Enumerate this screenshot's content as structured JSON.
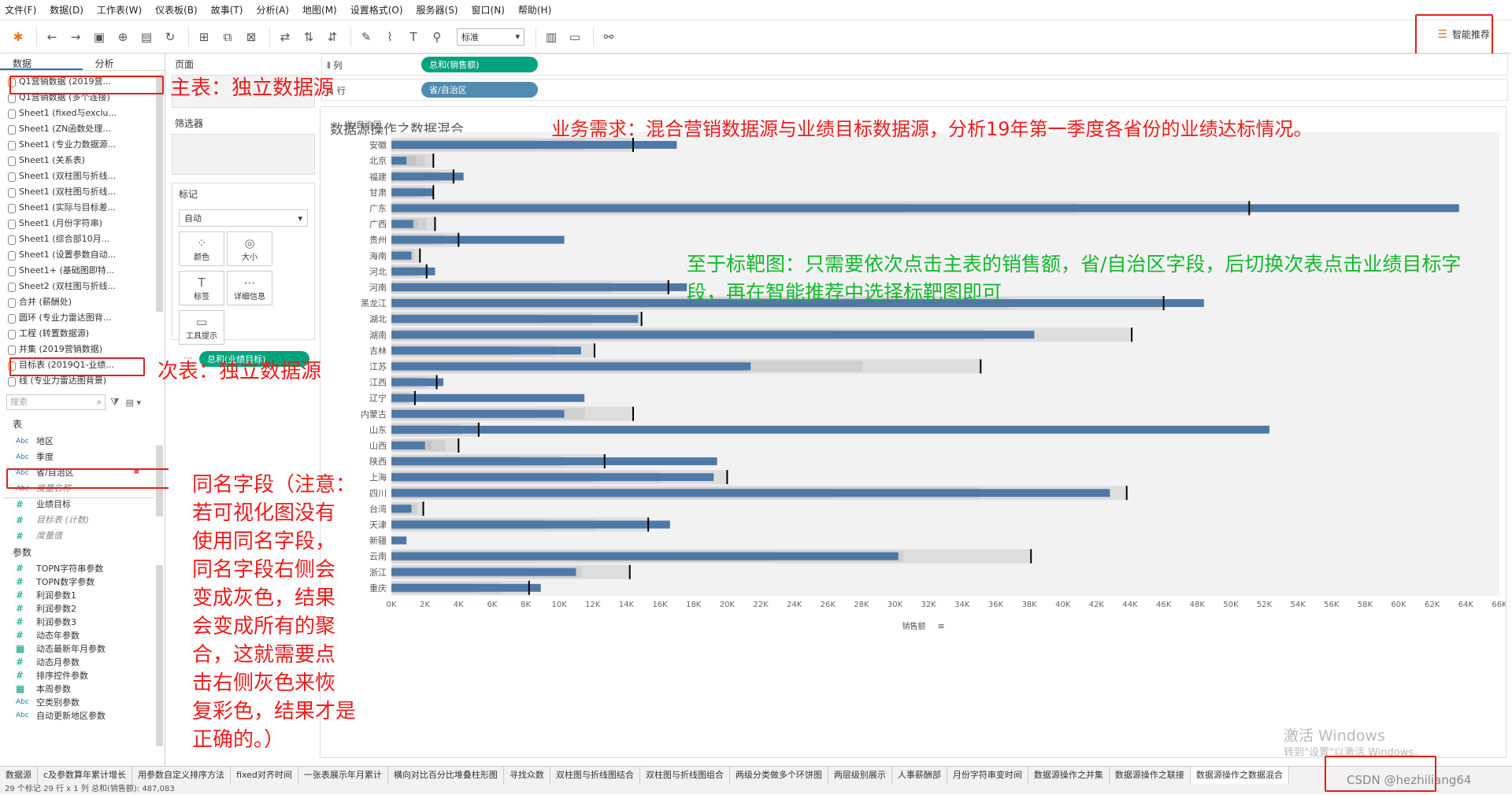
{
  "menu": [
    "文件(F)",
    "数据(D)",
    "工作表(W)",
    "仪表板(B)",
    "故事(T)",
    "分析(A)",
    "地图(M)",
    "设置格式(O)",
    "服务器(S)",
    "窗口(N)",
    "帮助(H)"
  ],
  "toolbar": {
    "fit_value": "标准",
    "smart_label": "智能推荐"
  },
  "left_tabs": {
    "data": "数据",
    "analysis": "分析"
  },
  "datasources": [
    "Q1营销数据 (2019营...",
    "Q1营销数据 (多个连接)",
    "Sheet1 (fixed与exclu...",
    "Sheet1 (ZN函数处理...",
    "Sheet1 (专业力数据源...",
    "Sheet1 (关系表)",
    "Sheet1 (双柱图与折线...",
    "Sheet1 (双柱图与折线...",
    "Sheet1 (实际与目标差...",
    "Sheet1 (月份字符串)",
    "Sheet1 (综合部10月...",
    "Sheet1 (设置参数自动...",
    "Sheet1+ (基础图即特...",
    "Sheet2 (双柱图与折线...",
    "合并 (薪酬处)",
    "圆环 (专业力雷达图背...",
    "工程 (转置数据源)",
    "并集 (2019营销数据)",
    "目标表 (2019Q1-业绩...",
    "线 (专业力雷达图背景)"
  ],
  "search": {
    "placeholder": "搜索"
  },
  "tables_header": "表",
  "fields": [
    {
      "type": "Abc",
      "name": "地区"
    },
    {
      "type": "Abc",
      "name": "季度"
    },
    {
      "type": "Abc",
      "name": "省/自治区"
    },
    {
      "type": "Abc",
      "name": "度量名称",
      "italic": true
    },
    {
      "type": "#",
      "name": "业绩目标"
    },
    {
      "type": "#",
      "name": "目标表 (计数)",
      "italic": true
    },
    {
      "type": "#",
      "name": "度量值",
      "italic": true
    }
  ],
  "params_header": "参数",
  "params": [
    {
      "type": "#",
      "name": "TOPN字符串参数"
    },
    {
      "type": "#",
      "name": "TOPN数字参数"
    },
    {
      "type": "#",
      "name": "利润参数1"
    },
    {
      "type": "#",
      "name": "利润参数2"
    },
    {
      "type": "#",
      "name": "利润参数3"
    },
    {
      "type": "#",
      "name": "动态年参数"
    },
    {
      "type": "▦",
      "name": "动态最新年月参数"
    },
    {
      "type": "#",
      "name": "动态月参数"
    },
    {
      "type": "#",
      "name": "排序控件参数"
    },
    {
      "type": "▦",
      "name": "本周参数"
    },
    {
      "type": "Abc",
      "name": "空类别参数"
    },
    {
      "type": "Abc",
      "name": "自动更新地区参数"
    }
  ],
  "middle": {
    "pages": "页面",
    "filters": "筛选器",
    "marks": "标记",
    "marks_type": "自动",
    "mark_buttons": [
      {
        "icon": "⁘",
        "label": "颜色"
      },
      {
        "icon": "◎",
        "label": "大小"
      },
      {
        "icon": "T",
        "label": "标签"
      },
      {
        "icon": "⋯",
        "label": "详细信息"
      },
      {
        "icon": "▭",
        "label": "工具提示"
      }
    ],
    "mark_pill": "总和(业绩目标)"
  },
  "shelves": {
    "cols_label": "列",
    "rows_label": "行",
    "cols_pill": "总和(销售额)",
    "rows_pill": "省/自治区"
  },
  "chart_data": {
    "type": "bar",
    "title": "数据源操作之数据混合",
    "row_header": "省/自治区",
    "xlabel": "销售额",
    "xlim": [
      0,
      66000
    ],
    "x_ticks": [
      "0K",
      "2K",
      "4K",
      "6K",
      "8K",
      "10K",
      "12K",
      "14K",
      "16K",
      "18K",
      "20K",
      "22K",
      "24K",
      "26K",
      "28K",
      "30K",
      "32K",
      "34K",
      "36K",
      "38K",
      "40K",
      "42K",
      "44K",
      "46K",
      "48K",
      "50K",
      "52K",
      "54K",
      "56K",
      "58K",
      "60K",
      "62K",
      "64K",
      "66K"
    ],
    "categories": [
      "安徽",
      "北京",
      "福建",
      "甘肃",
      "广东",
      "广西",
      "贵州",
      "海南",
      "河北",
      "河南",
      "黑龙江",
      "湖北",
      "湖南",
      "吉林",
      "江苏",
      "江西",
      "辽宁",
      "内蒙古",
      "山东",
      "山西",
      "陕西",
      "上海",
      "四川",
      "台湾",
      "天津",
      "新疆",
      "云南",
      "浙江",
      "重庆"
    ],
    "series": [
      {
        "name": "总和(销售额)",
        "values": [
          17000,
          900,
          4300,
          2500,
          63600,
          1300,
          10300,
          1200,
          2600,
          17600,
          48400,
          14700,
          38300,
          11300,
          21400,
          3100,
          11500,
          10300,
          52300,
          2000,
          19400,
          19200,
          42800,
          1200,
          16600,
          900,
          30200,
          11000,
          8900
        ]
      },
      {
        "name": "总和(业绩目标)",
        "values": [
          14400,
          2500,
          3700,
          2500,
          51100,
          2600,
          4000,
          1700,
          2100,
          16500,
          46000,
          14900,
          44100,
          12100,
          35100,
          2700,
          1400,
          14400,
          5200,
          4000,
          12700,
          20000,
          43800,
          1900,
          15300,
          null,
          38100,
          14200,
          8200
        ]
      }
    ]
  },
  "annotations": {
    "main_table": "主表：独立数据源",
    "secondary_table": "次表：独立数据源",
    "requirement": "业务需求：混合营销数据源与业绩目标数据源，分析19年第一季度各省份的业绩达标情况。",
    "bullet": "至于标靶图：只需要依次点击主表的销售额，省/自治区字段，后切换次表点击业绩目标字段，再在智能推荐中选择标靶图即可",
    "same_field": "同名字段（注意：\n若可视化图没有\n使用同名字段，\n同名字段右侧会\n变成灰色，结果\n会变成所有的聚\n合，这就需要点\n击右侧灰色来恢\n复彩色，结果才是正确的。）"
  },
  "sheet_tabs": [
    "数据源",
    "c及参数算年累计增长",
    "用参数自定义排序方法",
    "fixed对齐时间",
    "一张表展示年月累计",
    "横向对比百分比堆叠柱形图",
    "寻找众数",
    "双柱图与折线图结合",
    "双柱图与折线图组合",
    "两级分类做多个环饼图",
    "两层级别展示",
    "人事薪酬部",
    "月份字符串变时间",
    "数据源操作之并集",
    "数据源操作之联接",
    "数据源操作之数据混合"
  ],
  "status": "29 个标记    29 行 x 1 列    总和(销售额): 487,083",
  "watermark": {
    "line1": "激活 Windows",
    "line2": "转到\"设置\"以激活 Windows。",
    "csdn": "CSDN @hezhiliang64"
  }
}
